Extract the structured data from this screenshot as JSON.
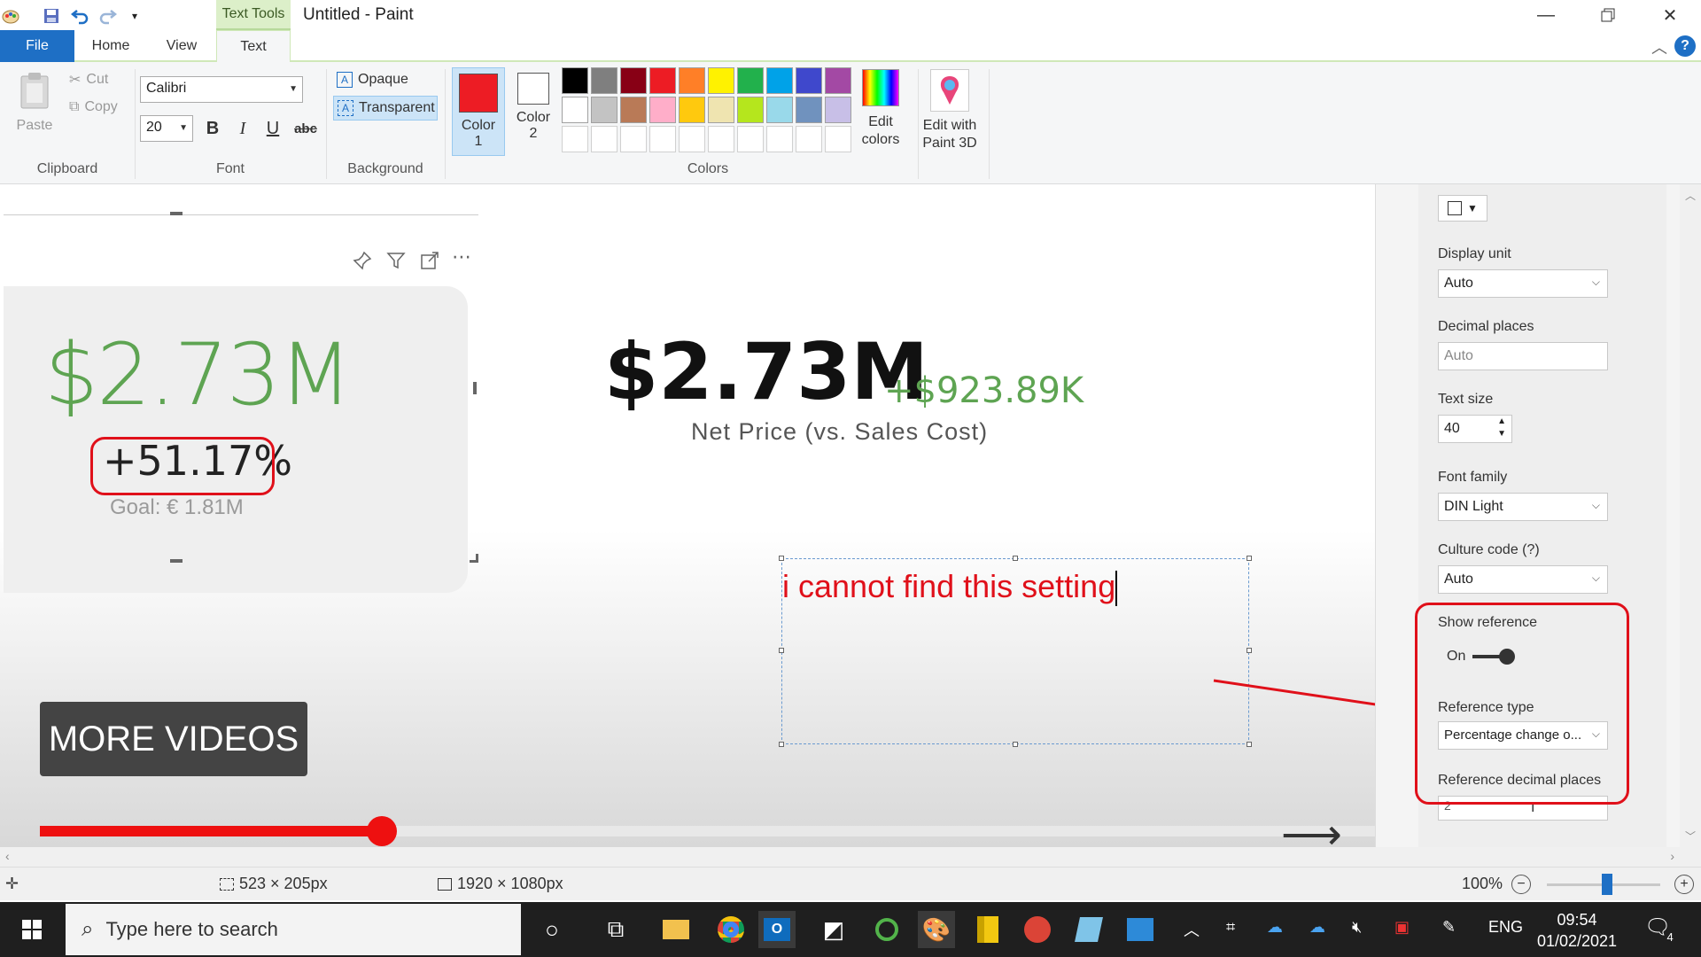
{
  "window": {
    "title": "Untitled - Paint",
    "contextual_tab": "Text Tools"
  },
  "tabs": {
    "file": "File",
    "home": "Home",
    "view": "View",
    "text": "Text"
  },
  "ribbon": {
    "clipboard": {
      "paste": "Paste",
      "cut": "Cut",
      "copy": "Copy",
      "label": "Clipboard"
    },
    "font": {
      "family": "Calibri",
      "size": "20",
      "bold": "B",
      "italic": "I",
      "underline": "U",
      "strike": "abc",
      "label": "Font"
    },
    "background": {
      "opaque": "Opaque",
      "transparent": "Transparent",
      "label": "Background"
    },
    "colors": {
      "color1": "Color",
      "color1_num": "1",
      "color2": "Color",
      "color2_num": "2",
      "label": "Colors",
      "color1_value": "#ed1c24",
      "color2_value": "#ffffff",
      "palette_row1": [
        "#000000",
        "#7f7f7f",
        "#880015",
        "#ed1c24",
        "#ff7f27",
        "#fff200",
        "#22b14c",
        "#00a2e8",
        "#3f48cc",
        "#a349a4"
      ],
      "palette_row2": [
        "#ffffff",
        "#c3c3c3",
        "#b97a57",
        "#ffaec9",
        "#ffc90e",
        "#efe4b0",
        "#b5e61d",
        "#99d9ea",
        "#7092be",
        "#c8bfe7"
      ]
    },
    "edit_colors": {
      "line1": "Edit",
      "line2": "colors"
    },
    "edit_3d": {
      "line1": "Edit with",
      "line2": "Paint 3D"
    }
  },
  "canvas": {
    "kpi_value": "$2.73M",
    "kpi_percent": "+51.17%",
    "kpi_goal": "Goal: € 1.81M",
    "main_value": "$2.73M",
    "main_delta": "+$923.89K",
    "main_caption": "Net Price (vs. Sales Cost)",
    "typed_text": "i cannot find this setting",
    "more_videos": "MORE VIDEOS",
    "video_progress": 0.21
  },
  "format_pane": {
    "display_unit_label": "Display unit",
    "display_unit_value": "Auto",
    "decimal_places_label": "Decimal places",
    "decimal_places_placeholder": "Auto",
    "text_size_label": "Text size",
    "text_size_value": "40",
    "font_family_label": "Font family",
    "font_family_value": "DIN Light",
    "culture_code_label": "Culture code (?)",
    "culture_code_value": "Auto",
    "show_reference_label": "Show reference",
    "show_reference_state": "On",
    "reference_type_label": "Reference type",
    "reference_type_value": "Percentage change o...",
    "reference_decimal_label": "Reference decimal places",
    "reference_decimal_value": "2"
  },
  "statusbar": {
    "selection_size": "523 × 205px",
    "canvas_size": "1920 × 1080px",
    "zoom": "100%"
  },
  "taskbar": {
    "search_placeholder": "Type here to search",
    "language": "ENG",
    "time": "09:54",
    "date": "01/02/2021",
    "notifications": "4"
  },
  "colors": {
    "accent": "#1e6fc5",
    "annotation_red": "#e0101a",
    "kpi_green": "#5ea452"
  }
}
